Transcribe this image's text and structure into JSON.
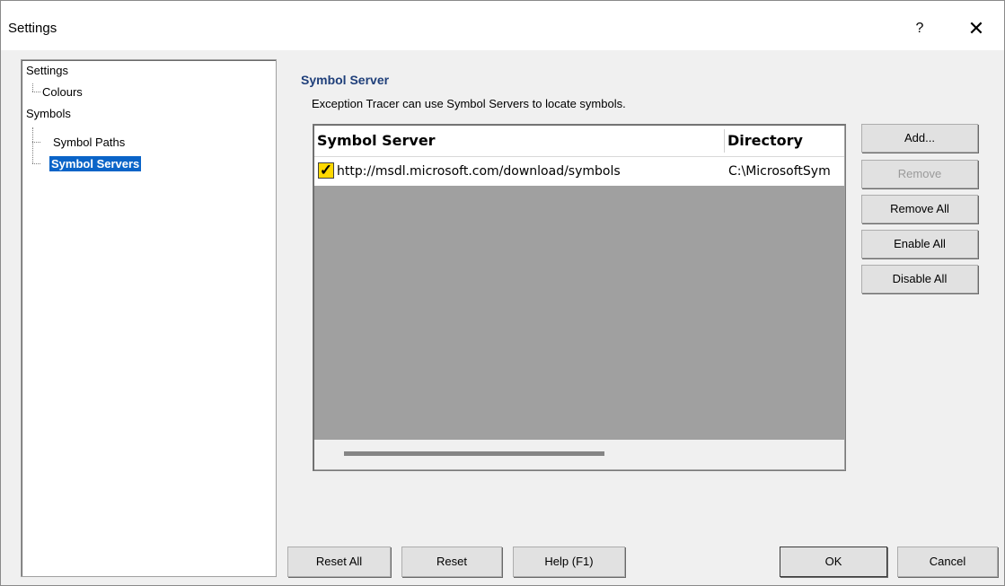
{
  "window": {
    "title": "Settings",
    "help_label": "?",
    "close_label": "✕"
  },
  "tree": {
    "items": [
      {
        "label": "Settings"
      },
      {
        "label": "Colours"
      },
      {
        "label": "Symbols"
      },
      {
        "label": "Symbol Paths"
      },
      {
        "label": "Symbol Servers",
        "selected": true
      }
    ]
  },
  "panel": {
    "title": "Symbol Server",
    "description": "Exception Tracer can use Symbol Servers to locate symbols."
  },
  "servers_list": {
    "columns": [
      "Symbol Server",
      "Directory"
    ],
    "rows": [
      {
        "checked": true,
        "server": "http://msdl.microsoft.com/download/symbols",
        "directory": "C:\\MicrosoftSym"
      }
    ]
  },
  "side_buttons": {
    "add": "Add...",
    "remove": "Remove",
    "remove_all": "Remove All",
    "enable_all": "Enable All",
    "disable_all": "Disable All"
  },
  "bottom_buttons": {
    "reset_all": "Reset All",
    "reset": "Reset",
    "help": "Help (F1)",
    "ok": "OK",
    "cancel": "Cancel"
  },
  "colors": {
    "selection": "#0a64c8",
    "section_title": "#1f3f7a",
    "checkbox_fill": "#ffd800",
    "list_background": "#a0a0a0"
  }
}
